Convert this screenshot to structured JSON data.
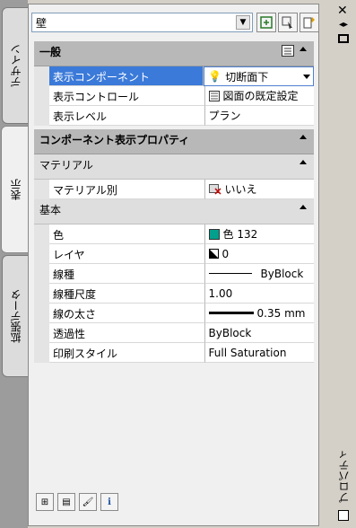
{
  "tabs": [
    {
      "label": "デザイン",
      "active": false
    },
    {
      "label": "表示",
      "active": true
    },
    {
      "label": "拡張データ",
      "active": false
    }
  ],
  "object_combo": {
    "value": "壁"
  },
  "window_title": "プロパティ",
  "sections": {
    "general": {
      "title": "一般"
    },
    "component_props": {
      "title": "コンポーネント表示プロパティ"
    },
    "material": {
      "title": "マテリアル"
    },
    "basic": {
      "title": "基本"
    }
  },
  "general_rows": [
    {
      "name": "表示コンポーネント",
      "value": "切断面下",
      "icon": "lightbulb-icon"
    },
    {
      "name": "表示コントロール",
      "value": "図面の既定設定",
      "icon": "display-control-icon"
    },
    {
      "name": "表示レベル",
      "value": "プラン"
    }
  ],
  "material_rows": [
    {
      "name": "マテリアル別",
      "value": "いいえ",
      "icon": "material-off-icon"
    }
  ],
  "basic_rows": [
    {
      "name": "色",
      "value": "色 132",
      "color": "#00a08c"
    },
    {
      "name": "レイヤ",
      "value": "0"
    },
    {
      "name": "線種",
      "value": "ByBlock"
    },
    {
      "name": "線種尺度",
      "value": "1.00"
    },
    {
      "name": "線の太さ",
      "value": "0.35 mm"
    },
    {
      "name": "透過性",
      "value": "ByBlock"
    },
    {
      "name": "印刷スタイル",
      "value": "Full Saturation"
    }
  ]
}
